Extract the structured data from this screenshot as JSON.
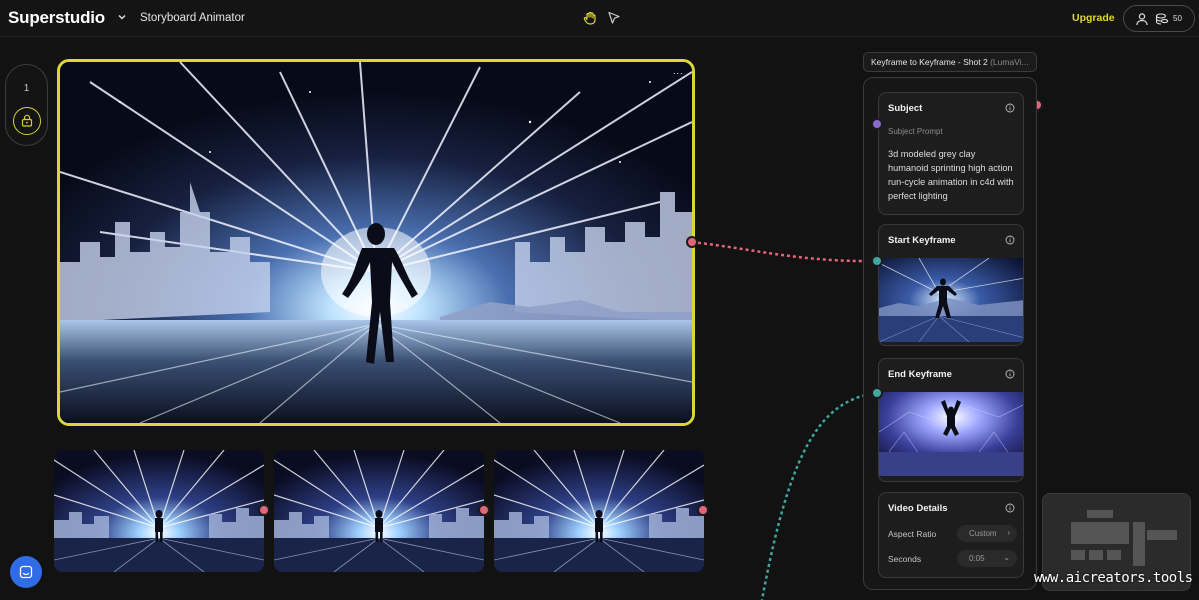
{
  "app": {
    "brand": "Superstudio",
    "project_title": "Storyboard Animator",
    "upgrade_label": "Upgrade",
    "credits": "50",
    "accent_color": "#dcd63a"
  },
  "icons": {
    "brand_menu": "chevron-down-icon",
    "hand_tool": "hand-icon",
    "select_tool": "pointer-icon",
    "account": "user-icon",
    "credits": "coins-icon",
    "lock": "lock-icon",
    "chat": "chat-icon",
    "info": "info-icon"
  },
  "left_rail": {
    "shot_number": "1"
  },
  "canvas": {
    "main_menu": "...",
    "thumbnails": [
      {
        "name": "thumbnail-1"
      },
      {
        "name": "thumbnail-2"
      },
      {
        "name": "thumbnail-3"
      }
    ]
  },
  "node": {
    "title": "Keyframe to Keyframe - Shot 2",
    "title_model": "(LumaVi...",
    "subject": {
      "title": "Subject",
      "prompt_label": "Subject Prompt",
      "prompt_text": "3d modeled grey clay humanoid sprinting high action run-cycle animation in c4d with perfect lighting"
    },
    "start_keyframe": {
      "title": "Start Keyframe"
    },
    "end_keyframe": {
      "title": "End Keyframe"
    },
    "video_details": {
      "title": "Video Details",
      "aspect_label": "Aspect Ratio",
      "aspect_value": "Custom",
      "seconds_label": "Seconds",
      "seconds_value": "0:05"
    }
  },
  "watermark": "www.aicreators.tools"
}
